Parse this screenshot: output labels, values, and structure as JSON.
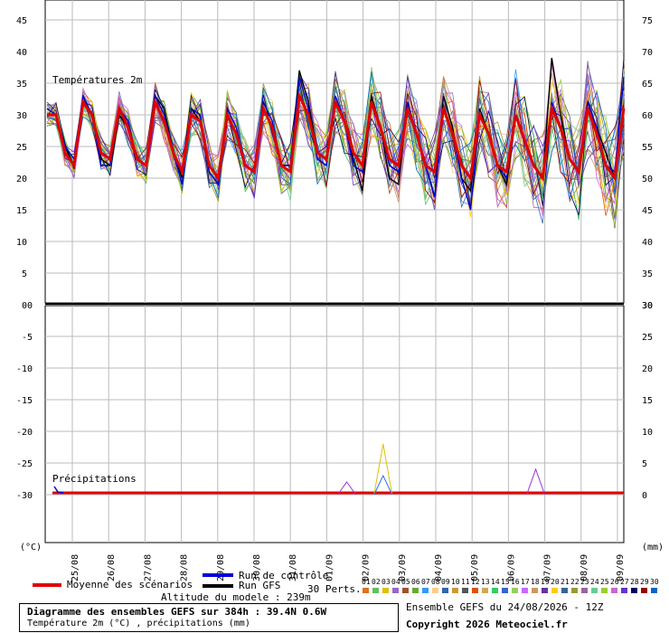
{
  "chart_data": {
    "type": "line",
    "upper_panel": {
      "title": "Températures 2m",
      "left_axis": {
        "ticks": [
          0,
          5,
          10,
          15,
          20,
          25,
          30,
          35,
          40,
          45
        ],
        "range": [
          0,
          47.5
        ]
      },
      "right_axis": {
        "ticks": [
          30,
          35,
          40,
          45,
          50,
          55,
          60,
          65,
          70,
          75
        ]
      },
      "series": [
        {
          "name": "Moyenne des scénarios",
          "color": "#e00000",
          "values": [
            30,
            30,
            24,
            22,
            32,
            30,
            24,
            23,
            31,
            28,
            23,
            22,
            32,
            29,
            24,
            21,
            30,
            29,
            22,
            20,
            30,
            27,
            22,
            21,
            31,
            28,
            22,
            21,
            33,
            30,
            24,
            23,
            32,
            29,
            24,
            22,
            32,
            28,
            23,
            22,
            31,
            27,
            22,
            21,
            31,
            27,
            22,
            20,
            30,
            27,
            22,
            21,
            30,
            26,
            22,
            20,
            31,
            28,
            23,
            21,
            31,
            27,
            22,
            20,
            31
          ]
        },
        {
          "name": "Run de contrôle",
          "color": "#0000cc",
          "values": [
            31,
            30,
            25,
            23,
            33,
            30,
            22,
            22,
            31,
            29,
            23,
            22,
            33,
            30,
            24,
            19,
            31,
            30,
            21,
            19,
            31,
            28,
            22,
            21,
            32,
            29,
            22,
            22,
            36,
            31,
            23,
            22,
            33,
            29,
            22,
            21,
            32,
            28,
            22,
            21,
            32,
            27,
            22,
            17,
            31,
            27,
            20,
            15,
            30,
            27,
            22,
            20,
            30,
            26,
            22,
            20,
            32,
            28,
            23,
            21,
            32,
            28,
            22,
            21,
            36
          ]
        },
        {
          "name": "Run GFS",
          "color": "#000000",
          "values": [
            30,
            30,
            25,
            22,
            32,
            30,
            23,
            22,
            30,
            28,
            23,
            22,
            33,
            31,
            24,
            20,
            31,
            29,
            21,
            19,
            30,
            27,
            22,
            21,
            31,
            28,
            22,
            22,
            37,
            32,
            24,
            23,
            32,
            29,
            23,
            18,
            33,
            28,
            20,
            19,
            32,
            27,
            22,
            17,
            33,
            28,
            20,
            18,
            31,
            27,
            22,
            19,
            30,
            26,
            22,
            20,
            39,
            30,
            23,
            21,
            31,
            28,
            24,
            20,
            31
          ]
        }
      ]
    },
    "lower_panel": {
      "title": "Précipitations",
      "left_axis": {
        "ticks": [
          0,
          -5,
          -10,
          -15,
          -20,
          -25,
          -30
        ]
      },
      "right_axis": {
        "ticks": [
          30,
          25,
          20,
          15,
          10,
          5,
          0
        ]
      },
      "units_left": "(°C)",
      "units_right": "(mm)",
      "peaks": [
        {
          "date_index": 8.8,
          "value": 8,
          "color": "#e0c000"
        },
        {
          "date_index": 8.8,
          "value": 3,
          "color": "#3366ff"
        },
        {
          "date_index": 13.0,
          "value": 4,
          "color": "#9933cc"
        },
        {
          "date_index": 7.8,
          "value": 2,
          "color": "#9933cc"
        }
      ]
    },
    "x_tick_labels": [
      "25/08",
      "26/08",
      "27/08",
      "28/08",
      "29/08",
      "30/08",
      "31/08",
      "01/09",
      "02/09",
      "03/09",
      "04/09",
      "05/09",
      "06/09",
      "07/09",
      "08/09",
      "09/09"
    ]
  },
  "legend": {
    "mean": "Moyenne des scénarios",
    "control": "Run de contrôle",
    "gfs": "Run GFS",
    "altitude": "Altitude du modele : 239m",
    "perts_label": "30 Perts.",
    "pert_numbers": [
      "01",
      "02",
      "03",
      "04",
      "05",
      "06",
      "07",
      "08",
      "09",
      "10",
      "11",
      "12",
      "13",
      "14",
      "15",
      "16",
      "17",
      "18",
      "19",
      "20",
      "21",
      "22",
      "23",
      "24",
      "25",
      "26",
      "27",
      "28",
      "29",
      "30"
    ],
    "pert_colors": [
      "#e07020",
      "#60c060",
      "#e0c000",
      "#9966cc",
      "#a0522d",
      "#66aa33",
      "#3399ff",
      "#ffcc88",
      "#3366aa",
      "#cc9933",
      "#555555",
      "#e05000",
      "#ccaa55",
      "#33cc66",
      "#3366cc",
      "#99cc66",
      "#cc66ff",
      "#cc9966",
      "#663399",
      "#ffcc00",
      "#336699",
      "#999933",
      "#996699",
      "#66cc99",
      "#99cc33",
      "#cc66cc",
      "#6633cc",
      "#000066",
      "#990000",
      "#0066cc"
    ]
  },
  "footer": {
    "title": "Diagramme des ensembles GEFS sur 384h : 39.4N 0.6W",
    "subtitle": "Température 2m (°C) , précipitations (mm)",
    "run_info": "Ensemble GEFS du 24/08/2026 - 12Z",
    "copyright": "Copyright 2026 Meteociel.fr"
  }
}
